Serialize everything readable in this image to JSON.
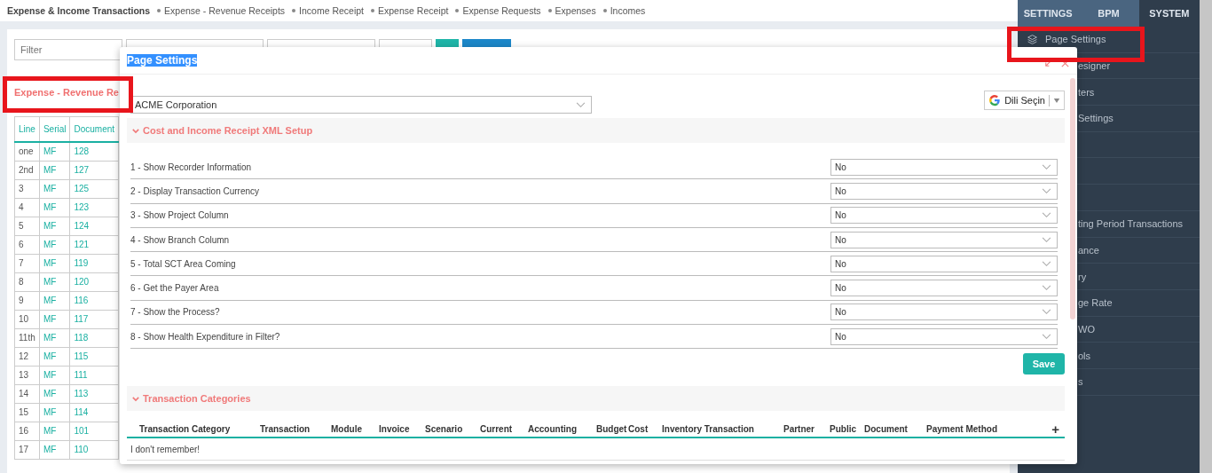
{
  "breadcrumb": {
    "title": "Expense & Income Transactions",
    "links": [
      "Expense - Revenue Receipts",
      "Income Receipt",
      "Expense Receipt",
      "Expense Requests",
      "Expenses",
      "Incomes"
    ]
  },
  "filter": {
    "placeholder": "Filter"
  },
  "list": {
    "title": "Expense - Revenue Re",
    "columns": [
      "Line",
      "Serial",
      "Document"
    ],
    "rows": [
      [
        "one",
        "MF",
        "128"
      ],
      [
        "2nd",
        "MF",
        "127"
      ],
      [
        "3",
        "MF",
        "125"
      ],
      [
        "4",
        "MF",
        "123"
      ],
      [
        "5",
        "MF",
        "124"
      ],
      [
        "6",
        "MF",
        "121"
      ],
      [
        "7",
        "MF",
        "119"
      ],
      [
        "8",
        "MF",
        "120"
      ],
      [
        "9",
        "MF",
        "116"
      ],
      [
        "10",
        "MF",
        "117"
      ],
      [
        "11th",
        "MF",
        "118"
      ],
      [
        "12",
        "MF",
        "115"
      ],
      [
        "13",
        "MF",
        "111"
      ],
      [
        "14",
        "MF",
        "113"
      ],
      [
        "15",
        "MF",
        "114"
      ],
      [
        "16",
        "MF",
        "101"
      ],
      [
        "17",
        "MF",
        "110"
      ]
    ]
  },
  "side_panel": {
    "tabs": [
      {
        "label": "SETTINGS",
        "selected": false
      },
      {
        "label": "BPM",
        "selected": false
      },
      {
        "label": "SYSTEM",
        "selected": true
      }
    ],
    "items": [
      {
        "label": "Page Settings",
        "kind": "visible"
      },
      {
        "label": "esigner",
        "kind": "covered"
      },
      {
        "label": "ters",
        "kind": "covered"
      },
      {
        "label": "Settings",
        "kind": "covered"
      },
      {
        "kind": "empty"
      },
      {
        "kind": "empty"
      },
      {
        "kind": "empty"
      },
      {
        "label": "ting Period Transactions",
        "kind": "covered"
      },
      {
        "label": "ance",
        "kind": "covered"
      },
      {
        "label": "ry",
        "kind": "covered"
      },
      {
        "label": "ge Rate",
        "kind": "covered"
      },
      {
        "label": "WO",
        "kind": "covered"
      },
      {
        "label": "ols",
        "kind": "covered"
      },
      {
        "label": "s",
        "kind": "covered"
      }
    ]
  },
  "modal": {
    "title": "Page Settings",
    "title_selected": true,
    "company": "ACME Corporation",
    "language": "Dili Seçin",
    "section_1": {
      "title": "Cost and Income Receipt XML Setup",
      "expanded": true,
      "settings": [
        {
          "label": "1 - Show Recorder Information",
          "value": "No"
        },
        {
          "label": "2 - Display Transaction Currency",
          "value": "No"
        },
        {
          "label": "3 - Show Project Column",
          "value": "No"
        },
        {
          "label": "4 - Show Branch Column",
          "value": "No"
        },
        {
          "label": "5 - Total SCT Area Coming",
          "value": "No"
        },
        {
          "label": "6 - Get the Payer Area",
          "value": "No"
        },
        {
          "label": "7 - Show the Process?",
          "value": "No"
        },
        {
          "label": "8 - Show Health Expenditure in Filter?",
          "value": "No"
        }
      ],
      "save": "Save"
    },
    "section_2": {
      "title": "Transaction Categories",
      "expanded": true,
      "columns": [
        "Transaction Category",
        "Transaction",
        "Module",
        "Invoice",
        "Scenario",
        "Current",
        "Accounting",
        "Budget",
        "Cost",
        "Inventory Transaction",
        "Partner",
        "Public",
        "Document",
        "Payment Method"
      ],
      "add": "+",
      "empty_text": "I don't remember!"
    }
  }
}
